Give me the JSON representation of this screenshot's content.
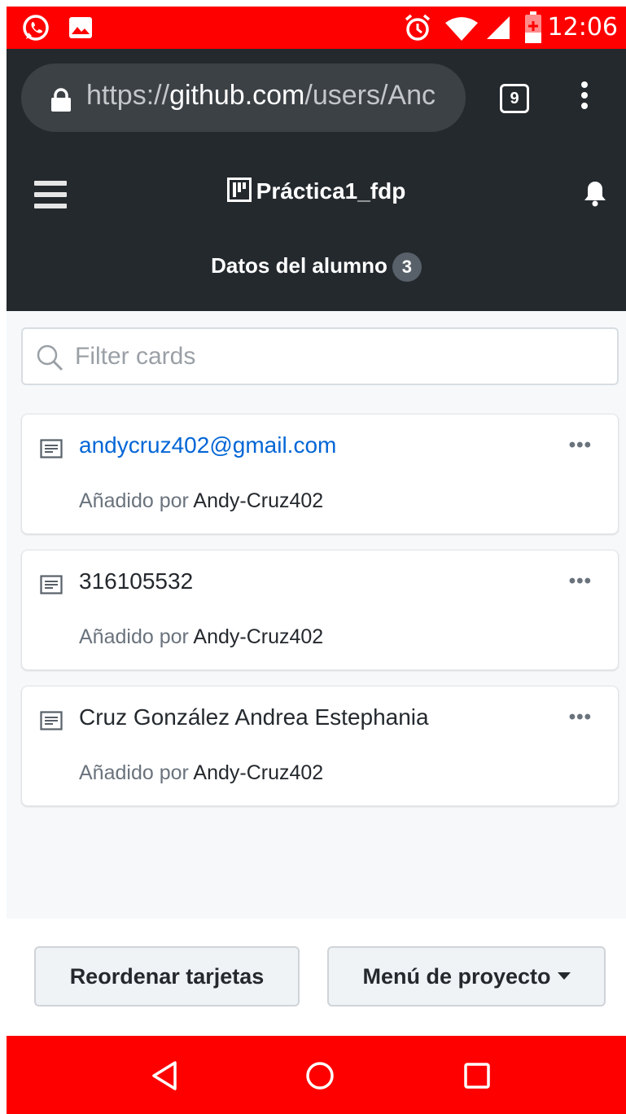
{
  "status_bar": {
    "time": "12:06",
    "icons": [
      "whatsapp-icon",
      "image-icon",
      "alarm-icon",
      "wifi-icon",
      "signal-icon",
      "battery-icon"
    ],
    "background": "#ff0000"
  },
  "browser": {
    "url_scheme": "https://",
    "url_host": "github.com",
    "url_path": "/users/Anc",
    "tab_count": "9"
  },
  "header": {
    "project_title": "Práctica1_fdp",
    "column_title": "Datos del alumno",
    "card_count": "3",
    "background": "#24292e"
  },
  "filter": {
    "placeholder": "Filter cards",
    "value": ""
  },
  "cards": [
    {
      "title": "andycruz402@gmail.com",
      "added_by_label": "Añadido por",
      "author": "Andy-Cruz402"
    },
    {
      "title": "316105532",
      "added_by_label": "Añadido por",
      "author": "Andy-Cruz402"
    },
    {
      "title": "Cruz González Andrea Estephania",
      "added_by_label": "Añadido por",
      "author": "Andy-Cruz402"
    }
  ],
  "more_label": "•••",
  "actions": {
    "reorder_label": "Reordenar tarjetas",
    "project_menu_label": "Menú de proyecto"
  },
  "colors": {
    "link": "#0366d6",
    "nav_bar": "#ff0000"
  }
}
